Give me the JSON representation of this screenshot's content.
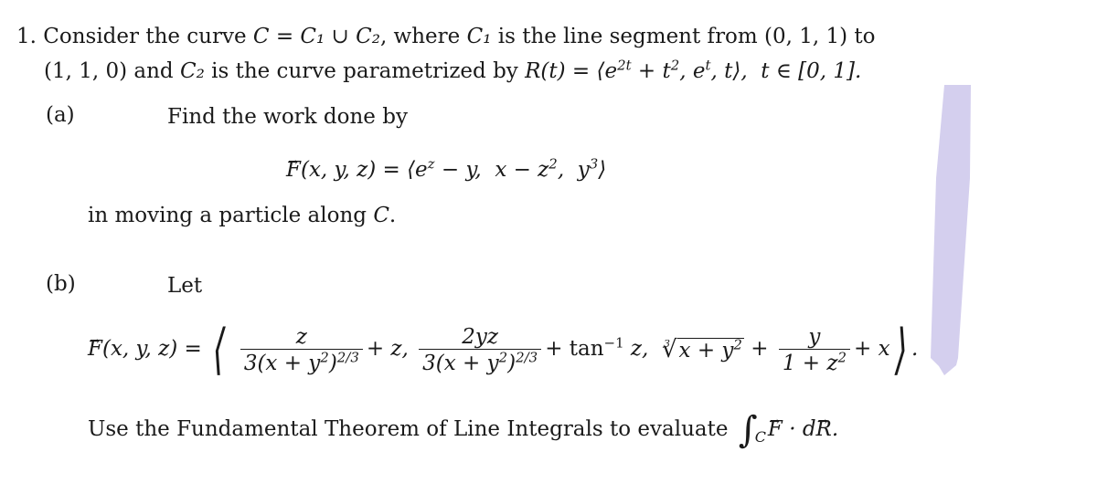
{
  "problem": {
    "number": "1.",
    "intro_line1_a": "Consider the curve ",
    "intro_line1_math": "C = C₁ ∪ C₂",
    "intro_line1_b": ", where ",
    "intro_line1_c1": "C₁",
    "intro_line1_c": " is the line segment from (0, 1, 1) to",
    "intro_line2_a": "(1, 1, 0) and ",
    "intro_line2_c2": "C₂",
    "intro_line2_b": " is the curve parametrized by ",
    "intro_line2_param": "R(t) = ⟨e^{2t} + t², e^t, t⟩,  t ∈ [0, 1]."
  },
  "part_a": {
    "label": "(a)",
    "instruction": "Find the work done by",
    "field_lhs": "F(x, y, z) =",
    "field_components": [
      "e^z − y",
      "x − z²",
      "y³"
    ],
    "after": "in moving a particle along C."
  },
  "part_b": {
    "label": "(b)",
    "instruction": "Let",
    "field_lhs": "F(x, y, z) =",
    "component1": {
      "numerator": "z",
      "denominator": "3(x + y²)^{2/3}",
      "tail": "+ z,"
    },
    "component2": {
      "numerator": "2yz",
      "denominator": "3(x + y²)^{2/3}",
      "tail": "+ tan⁻¹ z,"
    },
    "component3": {
      "root_index": "3",
      "radicand": "x + y²",
      "mid": "+",
      "numerator": "y",
      "denominator": "1 + z²",
      "tail": "+ x"
    },
    "end": ".",
    "task": "Use the Fundamental Theorem of Line Integrals to evaluate",
    "integral_limit": "C",
    "integrand": "F · dR."
  },
  "annotation": {
    "highlight_color": "#d4cfee"
  }
}
